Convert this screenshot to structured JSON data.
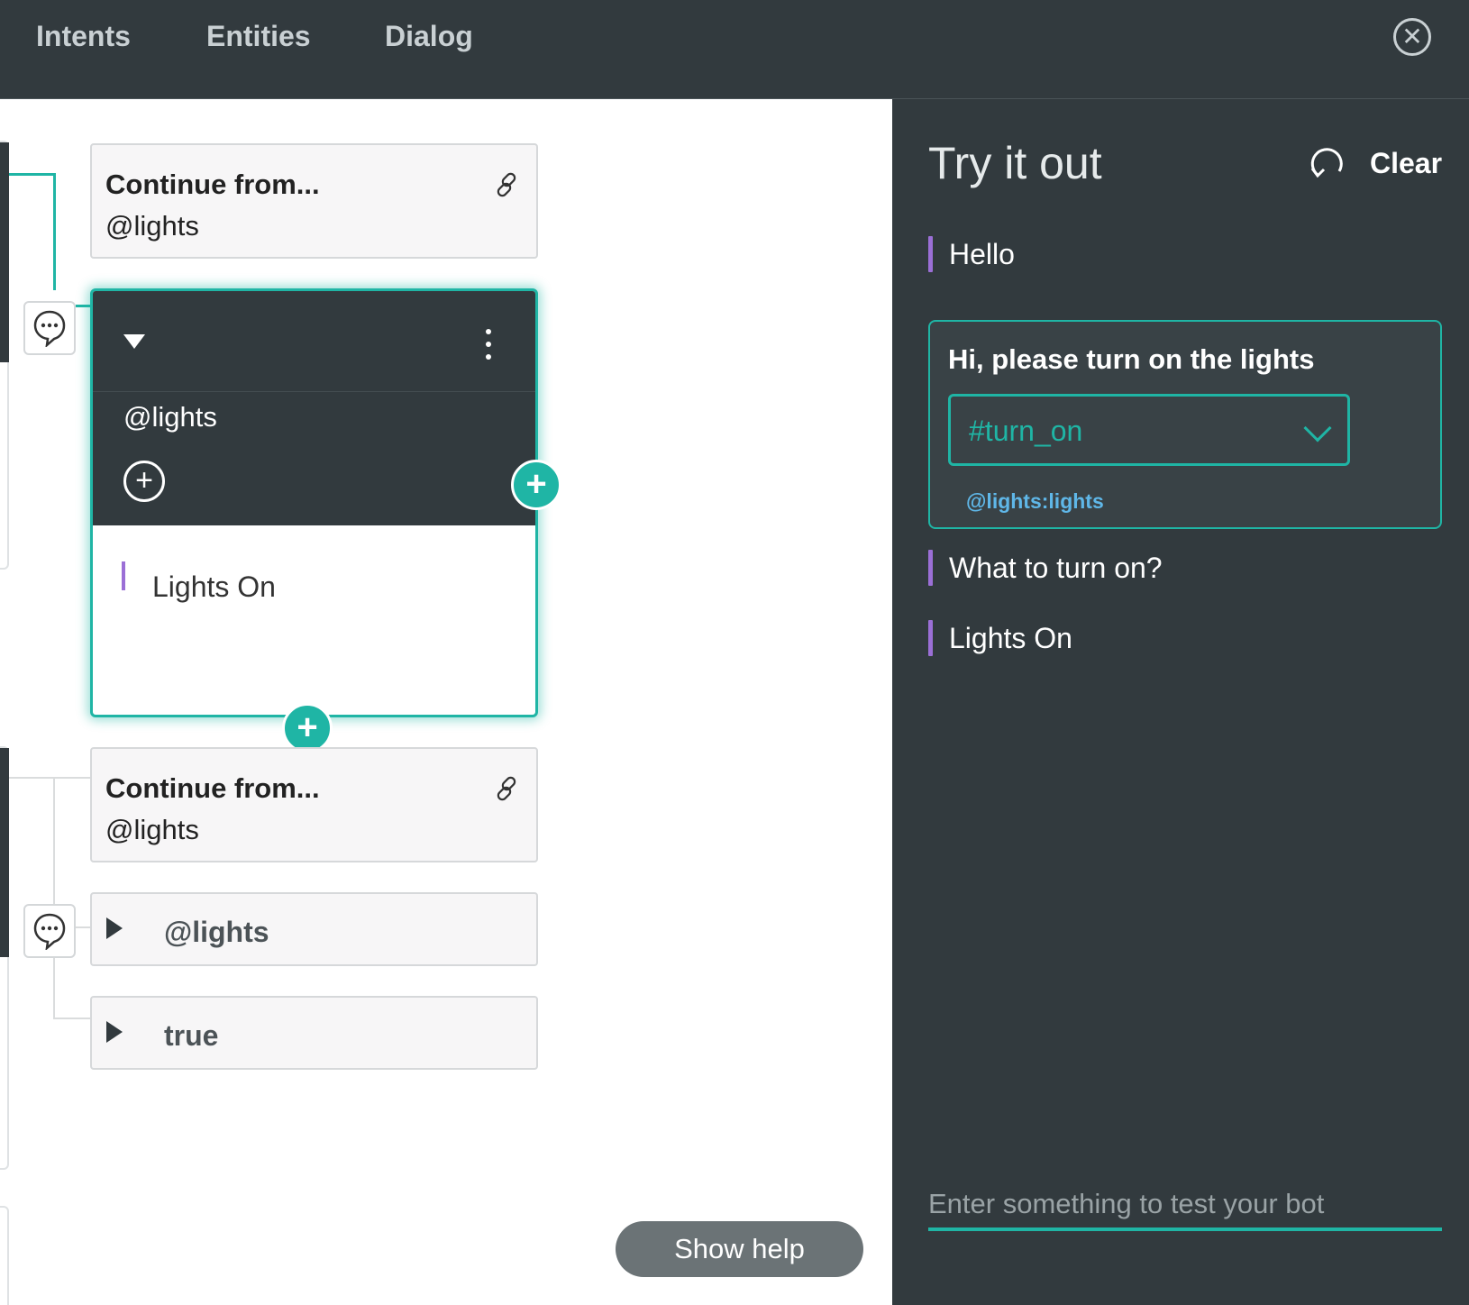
{
  "nav": {
    "tabs": [
      "Intents",
      "Entities",
      "Dialog"
    ]
  },
  "canvas": {
    "continue_card_1": {
      "title": "Continue from...",
      "condition": "@lights"
    },
    "selected_node": {
      "condition": "@lights",
      "response": "Lights On"
    },
    "continue_card_2": {
      "title": "Continue from...",
      "condition": "@lights"
    },
    "child_nodes": [
      "@lights",
      "true"
    ],
    "show_help": "Show help"
  },
  "try_panel": {
    "title": "Try it out",
    "clear_label": "Clear",
    "messages": {
      "bot_1": "Hello",
      "user_1": "Hi, please turn on the lights",
      "intent": "#turn_on",
      "entity": "@lights:lights",
      "bot_2": "What to turn on?",
      "bot_3": "Lights On"
    },
    "input_placeholder": "Enter something to test your bot"
  },
  "colors": {
    "accent": "#1fb5a5",
    "dark": "#323a3e",
    "response_bar": "#9b6fd6",
    "entity": "#5fb7e8"
  }
}
